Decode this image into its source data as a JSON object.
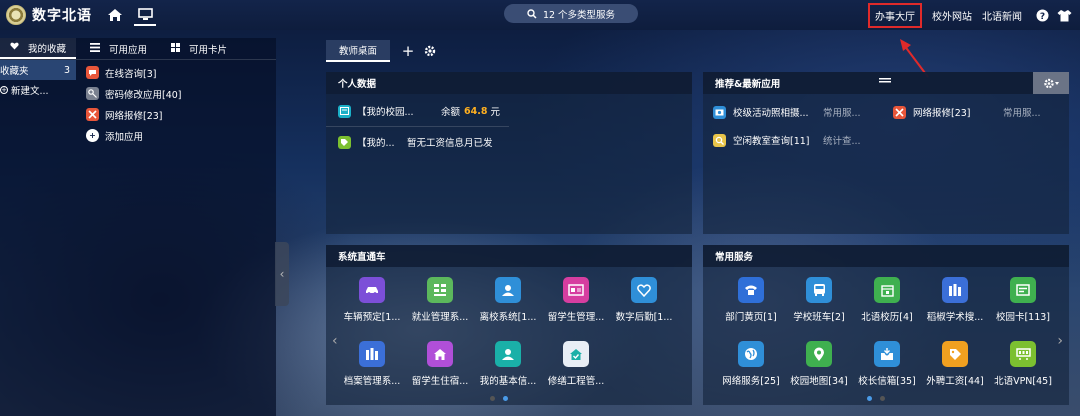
{
  "topbar": {
    "logo_text": "数字北语",
    "search_label": "12 个多类型服务",
    "links": [
      "办事大厅",
      "校外网站",
      "北语新闻"
    ]
  },
  "left": {
    "tabs": [
      "我的收藏",
      "可用应用",
      "可用卡片"
    ],
    "folders": [
      {
        "label": "收藏夹",
        "count": "3"
      },
      {
        "label": "新建文..."
      }
    ],
    "apps": [
      {
        "label": "在线咨询[3]",
        "color": "#e8563a",
        "icon": "chat-icon"
      },
      {
        "label": "密码修改应用[40]",
        "color": "#7a8190",
        "icon": "key-icon"
      },
      {
        "label": "网络报修[23]",
        "color": "#e8563a",
        "icon": "tools-icon"
      },
      {
        "label": "添加应用",
        "icon": "plus-icon"
      }
    ]
  },
  "workspace": {
    "tab": "教师桌面"
  },
  "personal": {
    "title": "个人数据",
    "row1_name": "【我的校园...",
    "row1_label": "余额",
    "row1_value": "64.8",
    "row1_unit": "元",
    "row2_name": "【我的...",
    "row2_text": "暂无工资信息月已发"
  },
  "recommend": {
    "title": "推荐&最新应用",
    "items": [
      {
        "name": "校级活动照相摄...",
        "cat": "常用服...",
        "color": "#2f8fd8"
      },
      {
        "name": "网络报修[23]",
        "cat": "常用服...",
        "color": "#e8563a"
      },
      {
        "name": "空闲教室查询[11]",
        "cat": "统计查...",
        "color": "#e8c44a"
      }
    ]
  },
  "express": {
    "title": "系统直通车",
    "tiles": [
      {
        "label": "车辆预定[1...",
        "color": "#7c4fd8",
        "icon": "car-icon"
      },
      {
        "label": "就业管理系...",
        "color": "#5cb85c",
        "icon": "grid-icon"
      },
      {
        "label": "离校系统[1...",
        "color": "#2f8fd8",
        "icon": "person-icon"
      },
      {
        "label": "留学生管理...",
        "color": "#d63ea0",
        "icon": "id-card-icon"
      },
      {
        "label": "数字后勤[1...",
        "color": "#2f8fd8",
        "icon": "heart-check-icon"
      },
      {
        "label": "档案管理系...",
        "color": "#3b6fd8",
        "icon": "archive-icon"
      },
      {
        "label": "留学生住宿...",
        "color": "#b04fd8",
        "icon": "house-icon"
      },
      {
        "label": "我的基本信...",
        "color": "#1ab0a8",
        "icon": "person-icon"
      },
      {
        "label": "修缮工程管...",
        "color": "#e8eef5",
        "icon": "house-check-icon"
      }
    ]
  },
  "services": {
    "title": "常用服务",
    "tiles": [
      {
        "label": "部门黄页[1]",
        "color": "#2f6fd8",
        "icon": "phone-icon"
      },
      {
        "label": "学校班车[2]",
        "color": "#2f8fd8",
        "icon": "bus-icon"
      },
      {
        "label": "北语校历[4]",
        "color": "#3fb04f",
        "icon": "calendar-icon"
      },
      {
        "label": "稻椒学术搜...",
        "color": "#3b6fd8",
        "icon": "book-icon"
      },
      {
        "label": "校园卡[113]",
        "color": "#3fb04f",
        "icon": "card-icon"
      },
      {
        "label": "网络服务[25]",
        "color": "#2f8fd8",
        "icon": "globe-icon"
      },
      {
        "label": "校园地图[34]",
        "color": "#3fb04f",
        "icon": "map-pin-icon"
      },
      {
        "label": "校长信箱[35]",
        "color": "#2f8fd8",
        "icon": "inbox-icon"
      },
      {
        "label": "外聘工资[44]",
        "color": "#f0a020",
        "icon": "tag-icon"
      },
      {
        "label": "北语VPN[45]",
        "color": "#7cc030",
        "icon": "vpn-icon"
      }
    ]
  }
}
